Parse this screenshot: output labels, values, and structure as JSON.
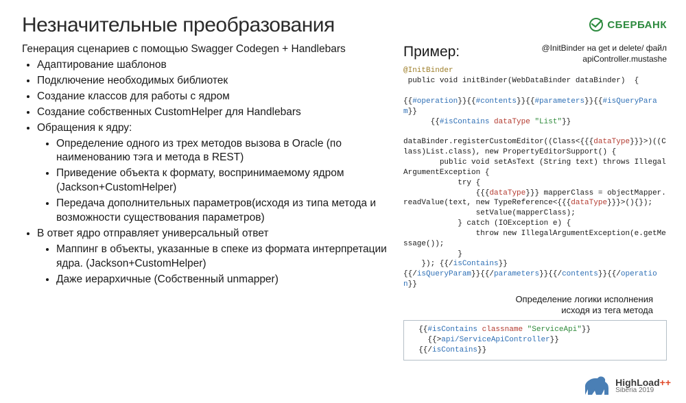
{
  "title": "Незначительные преобразования",
  "logo": {
    "text": "СБЕРБАНК"
  },
  "left": {
    "intro": "Генерация сценариев с помощью Swagger Codegen + Handlebars",
    "items": [
      "Адаптирование шаблонов",
      "Подключение необходимых библиотек",
      "Создание классов для работы с ядром",
      "Создание собственных CustomHelper для Handlebars",
      "Обращения к ядру:",
      "В ответ ядро отправляет универсальный ответ"
    ],
    "sub_core": [
      "Определение одного из трех методов вызова в Oracle (по наименованию тэга и метода в REST)",
      "Приведение объекта к формату, воспринимаемому ядром (Jackson+CustomHelper)",
      "Передача дополнительных параметров(исходя из типа метода и возможности существования параметров)"
    ],
    "sub_response": [
      "Маппинг в объекты, указанные в спеке из  формата интерпретации ядра. (Jackson+CustomHelper)",
      "Даже иерархичные (Собственный unmapper)"
    ]
  },
  "right": {
    "example_title": "Пример:",
    "annot_line1": "@InitBinder на get и delete/ файл",
    "annot_line2": "apiController.mustashe",
    "code1_l1a": "@InitBinder",
    "code1_l1b": " public void initBinder(WebDataBinder dataBinder)  {",
    "code1_blank": " ",
    "code1_op_open_a": "{{",
    "code1_op_open_b": "#operation",
    "code1_op_open_c": "}}{{",
    "code1_op_open_d": "#contents",
    "code1_op_open_e": "}}{{",
    "code1_op_open_f": "#parameters",
    "code1_op_open_g": "}}{{",
    "code1_op_open_h": "#isQueryParam",
    "code1_op_open_i": "}}",
    "code1_contains_a": "      {{",
    "code1_contains_b": "#isContains",
    "code1_contains_c": " dataType ",
    "code1_contains_d": "\"List\"",
    "code1_contains_e": "}}",
    "code1_reg_a": "dataBinder.registerCustomEditor((Class<{{{",
    "code1_reg_b": "dataType",
    "code1_reg_c": "}}}>)((Class)List.class), new PropertyEditorSupport() {",
    "code1_setas": "        public void setAsText (String text) throws IllegalArgumentException {",
    "code1_try": "            try {",
    "code1_mapa": "                {{{",
    "code1_mapb": "dataType",
    "code1_mapc": "}}} mapperClass = objectMapper.readValue(text, new TypeReference<{{{",
    "code1_mapd": "dataType",
    "code1_mape": "}}}>(){});",
    "code1_setv": "                setValue(mapperClass);",
    "code1_catch": "            } catch (IOException e) {",
    "code1_throw": "                throw new IllegalArgumentException(e.getMessage());",
    "code1_close1": "            }",
    "code1_close2a": "    }); {{/",
    "code1_close2b": "isContains",
    "code1_close2c": "}}",
    "code1_close3a": "{{/",
    "code1_close3b": "isQueryParam",
    "code1_close3c": "}}{{/",
    "code1_close3d": "parameters",
    "code1_close3e": "}}{{/",
    "code1_close3f": "contents",
    "code1_close3g": "}}{{/",
    "code1_close3h": "operation",
    "code1_close3i": "}}",
    "midtext_l1": "Определение логики исполнения",
    "midtext_l2": "исходя из тега метода",
    "code2_l1a": "  {{",
    "code2_l1b": "#isContains",
    "code2_l1c": " classname ",
    "code2_l1d": "\"ServiceApi\"",
    "code2_l1e": "}}",
    "code2_l2a": "    {{>",
    "code2_l2b": "api/ServiceApiController",
    "code2_l2c": "}}",
    "code2_l3a": "  {{/",
    "code2_l3b": "isContains",
    "code2_l3c": "}}"
  },
  "footer": {
    "main": "HighLoad",
    "plus": "++",
    "sub": "Siberia 2019"
  }
}
